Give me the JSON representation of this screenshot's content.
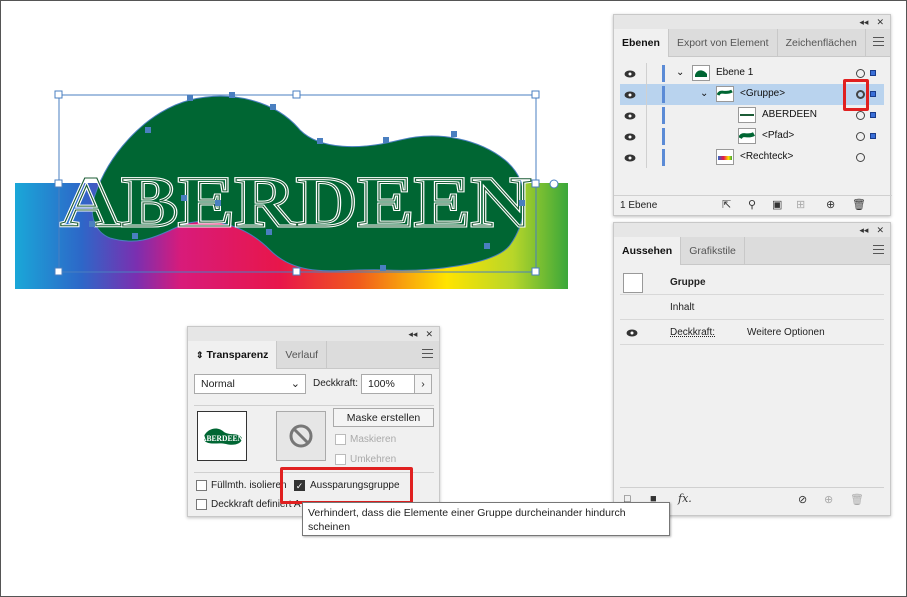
{
  "artwork": {
    "text": "ABERDEEN"
  },
  "layers_panel": {
    "tabs": [
      "Ebenen",
      "Export von Element",
      "Zeichenflächen"
    ],
    "rows": [
      {
        "name": "Ebene 1"
      },
      {
        "name": "<Gruppe>"
      },
      {
        "name": "ABERDEEN"
      },
      {
        "name": "<Pfad>"
      },
      {
        "name": "<Rechteck>"
      }
    ],
    "footer_count": "1 Ebene"
  },
  "appearance_panel": {
    "tabs": [
      "Aussehen",
      "Grafikstile"
    ],
    "title": "Gruppe",
    "content_label": "Inhalt",
    "opacity_label": "Deckkraft:",
    "opacity_value": "Weitere Optionen",
    "fx_label": "fx."
  },
  "transparency_panel": {
    "tabs": [
      "Transparenz",
      "Verlauf"
    ],
    "blend_mode": "Normal",
    "opacity_label": "Deckkraft:",
    "opacity_value": "100%",
    "thumb_text": "ABERDEEN",
    "make_mask_label": "Maske erstellen",
    "clip_label": "Maskieren",
    "invert_label": "Umkehren",
    "isolate_label": "Füllmth. isolieren",
    "knockout_label": "Aussparungsgruppe",
    "opacity_knockout_label": "Deckkraft definiert A",
    "knockout_checked": true
  },
  "tooltip": {
    "line1": "Verhindert, dass die Elemente einer Gruppe durcheinander hindurch",
    "line2": "scheinen"
  },
  "colors": {
    "layer_selection": "#b9d3ee",
    "highlight_red": "#e02020",
    "blob_green": "#006633",
    "layer_bar_blue": "#5b8bd6"
  }
}
